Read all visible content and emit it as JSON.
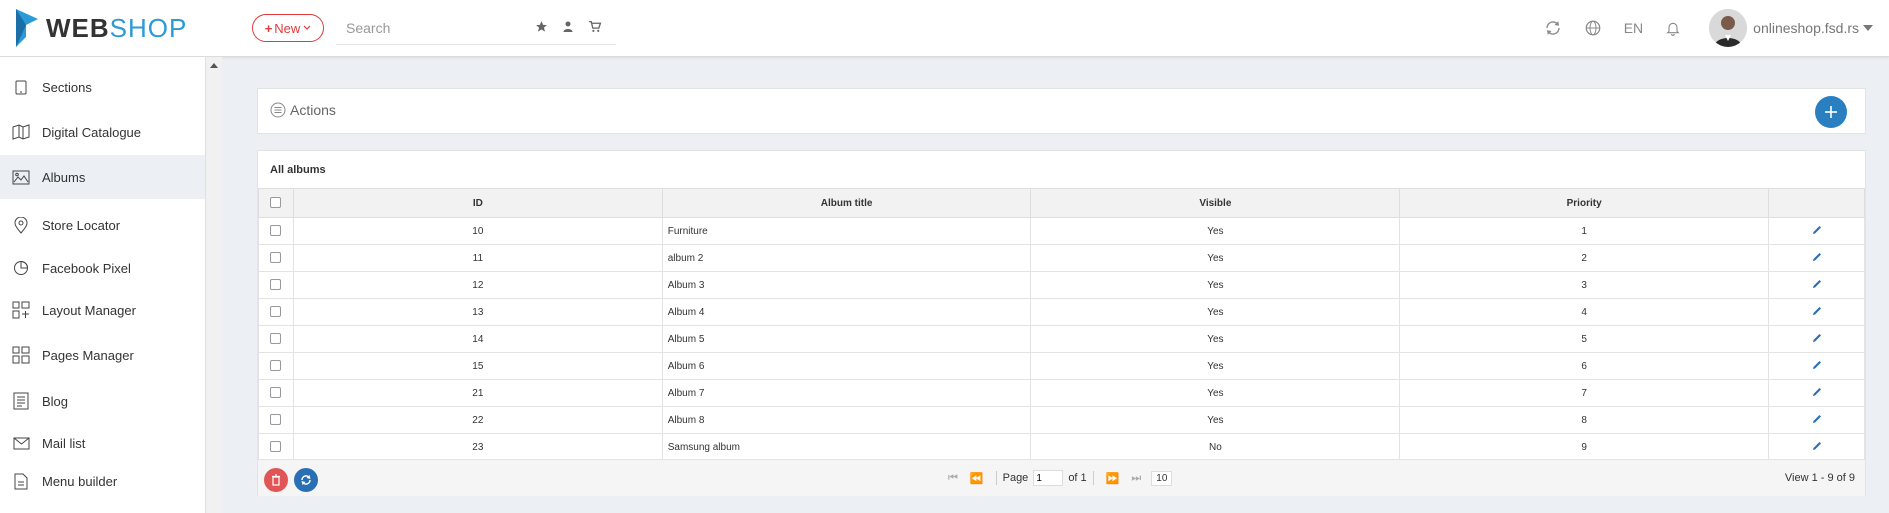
{
  "header": {
    "logo": {
      "part1": "WEB",
      "part2": "SHOP"
    },
    "new_label": "New",
    "search_placeholder": "Search",
    "language": "EN",
    "user": "onlineshop.fsd.rs"
  },
  "sidebar": {
    "items": [
      {
        "label": "Sections",
        "icon": "tablet-icon"
      },
      {
        "label": "Digital Catalogue",
        "icon": "catalogue-icon"
      },
      {
        "label": "Albums",
        "icon": "image-icon",
        "active": true
      },
      {
        "label": "Store Locator",
        "icon": "map-pin-icon"
      },
      {
        "label": "Facebook Pixel",
        "icon": "pie-chart-icon"
      },
      {
        "label": "Layout Manager",
        "icon": "layout-icon"
      },
      {
        "label": "Pages Manager",
        "icon": "pages-icon"
      },
      {
        "label": "Blog",
        "icon": "blog-icon"
      },
      {
        "label": "Mail list",
        "icon": "envelope-icon"
      },
      {
        "label": "Menu builder",
        "icon": "menu-builder-icon"
      }
    ]
  },
  "actions": {
    "label": "Actions"
  },
  "table": {
    "title": "All albums",
    "columns": [
      "ID",
      "Album title",
      "Visible",
      "Priority"
    ],
    "rows": [
      {
        "id": "10",
        "title": "Furniture",
        "visible": "Yes",
        "priority": "1"
      },
      {
        "id": "11",
        "title": "album 2",
        "visible": "Yes",
        "priority": "2"
      },
      {
        "id": "12",
        "title": "Album 3",
        "visible": "Yes",
        "priority": "3"
      },
      {
        "id": "13",
        "title": "Album 4",
        "visible": "Yes",
        "priority": "4"
      },
      {
        "id": "14",
        "title": "Album 5",
        "visible": "Yes",
        "priority": "5"
      },
      {
        "id": "15",
        "title": "Album 6",
        "visible": "Yes",
        "priority": "6"
      },
      {
        "id": "21",
        "title": "Album 7",
        "visible": "Yes",
        "priority": "7"
      },
      {
        "id": "22",
        "title": "Album 8",
        "visible": "Yes",
        "priority": "8"
      },
      {
        "id": "23",
        "title": "Samsung album",
        "visible": "No",
        "priority": "9"
      }
    ]
  },
  "pager": {
    "page_label": "Page",
    "page_value": "1",
    "of_label": "of 1",
    "rows_per_page": "10",
    "view_info": "View 1 - 9 of 9"
  },
  "colors": {
    "accent": "#2a7fc1",
    "danger": "#e03a3a",
    "brand": "#2b9ad6"
  }
}
